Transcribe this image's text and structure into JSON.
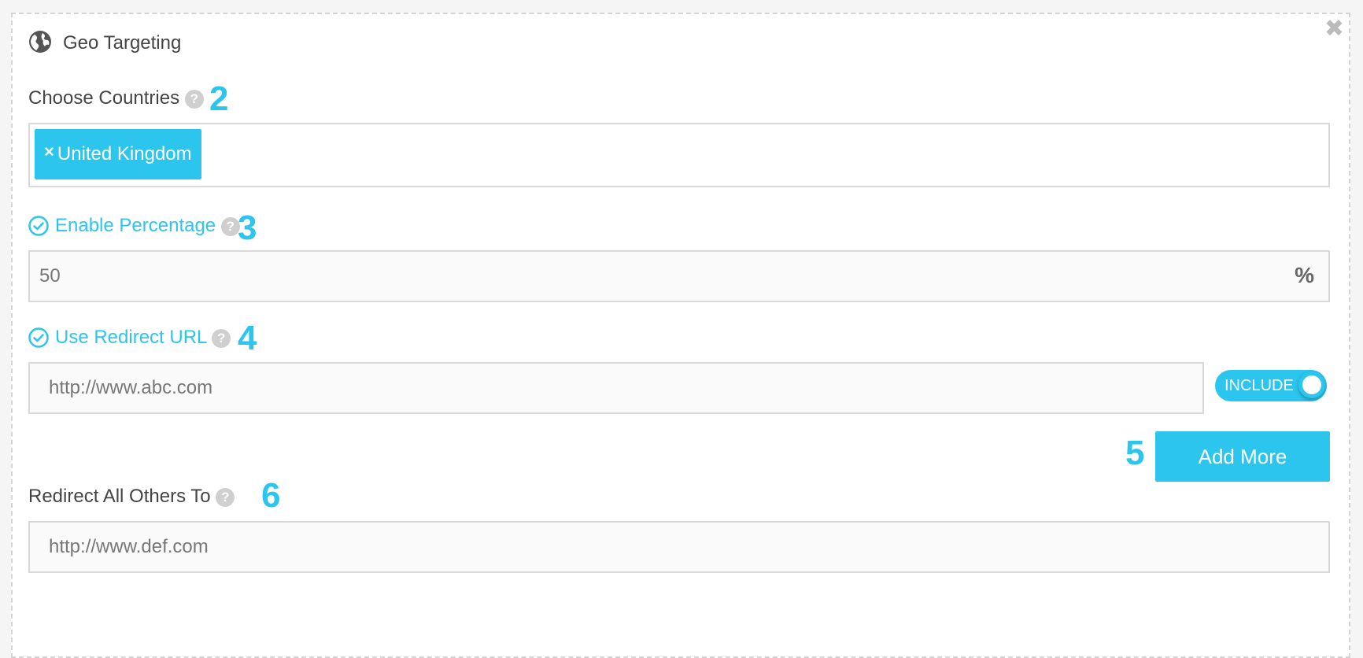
{
  "header": {
    "title": "Geo Targeting",
    "globe_icon": "globe-icon",
    "close_icon": "close-icon"
  },
  "countries": {
    "label": "Choose Countries",
    "help": "?",
    "step": "2",
    "tags": [
      {
        "remove": "×",
        "label": "United Kingdom"
      }
    ]
  },
  "percentage": {
    "label": "Enable Percentage",
    "help": "?",
    "step": "3",
    "value": "50",
    "suffix": "%",
    "checked": true
  },
  "redirect": {
    "label": "Use Redirect URL",
    "help": "?",
    "step": "4",
    "url": "http://www.abc.com",
    "toggle_label": "INCLUDE I",
    "checked": true
  },
  "add_more": {
    "step": "5",
    "label": "Add More"
  },
  "others": {
    "label": "Redirect All Others To",
    "help": "?",
    "step": "6",
    "url": "http://www.def.com"
  },
  "colors": {
    "accent": "#2bc5ee",
    "help": "#cfcfcf",
    "border": "#d9d9d9"
  }
}
